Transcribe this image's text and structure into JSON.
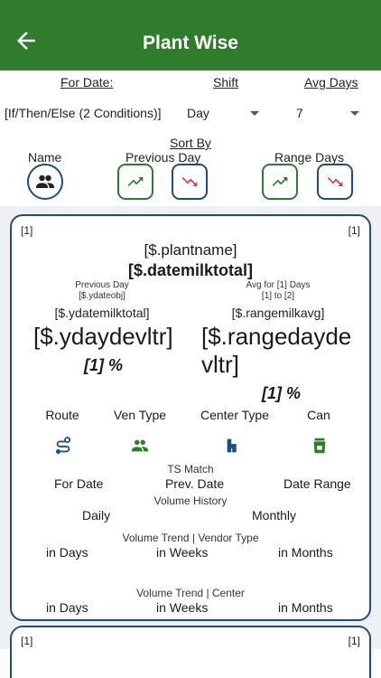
{
  "header": {
    "title": "Plant Wise"
  },
  "filters": {
    "for_date_label": "For Date:",
    "shift_label": "Shift",
    "avg_days_label": "Avg Days",
    "for_date_value": "[If/Then/Else (2 Conditions)]",
    "shift_value": "Day",
    "avg_days_value": "7"
  },
  "sort": {
    "title": "Sort By",
    "name_label": "Name",
    "previous_day_label": "Previous Day",
    "range_days_label": "Range Days"
  },
  "card": {
    "index_left": "[1]",
    "index_right": "[1]",
    "plant_name": "[$.plantname]",
    "date_milk_total": "[$.datemilktotal]",
    "previous_day_label": "Previous Day",
    "yda_date_obj": "[$.ydateobj]",
    "avg_for_label": "Avg for [1] Days",
    "range_label": "[1] to  [2]",
    "yda_milk_total": "[$.ydatemilktotal]",
    "range_milk_avg": "[$.rangemilkavg]",
    "yday_dev_ltr": "[$.ydaydevltr]",
    "yday_dev_pct": "[1] %",
    "range_dev_ltr_line1": "[$.rangedayde",
    "range_dev_ltr_line2": "vltr]",
    "range_dev_pct": "[1] %",
    "categories": [
      "Route",
      "Ven Type",
      "Center Type",
      "Can"
    ],
    "ts_match_label": "TS Match",
    "ts_for_date": "For Date",
    "ts_prev_date": "Prev. Date",
    "ts_date_range": "Date Range",
    "volume_history_label": "Volume History",
    "vh_daily": "Daily",
    "vh_monthly": "Monthly",
    "trend_vendor_label": "Volume Trend | Vendor Type",
    "tv_days": "in Days",
    "tv_weeks": "in Weeks",
    "tv_months": "in Months",
    "trend_center_label": "Volume Trend | Center",
    "tc_days": "in Days",
    "tc_weeks": "in Weeks",
    "tc_months": "in Months"
  },
  "card2": {
    "index_left": "[1]",
    "index_right": "[1]"
  },
  "icons": {
    "back": "arrow-left-icon",
    "group": "people-icon",
    "trend_up": "trending-up-icon",
    "trend_down": "trending-down-icon",
    "route": "route-icon",
    "ven_type": "people-icon",
    "center_type": "house-icon",
    "can": "milk-can-icon"
  },
  "colors": {
    "appbar": "#2f7d2c",
    "blue": "#1e4d86",
    "green": "#2f7d2c",
    "red": "#d23a5a"
  }
}
